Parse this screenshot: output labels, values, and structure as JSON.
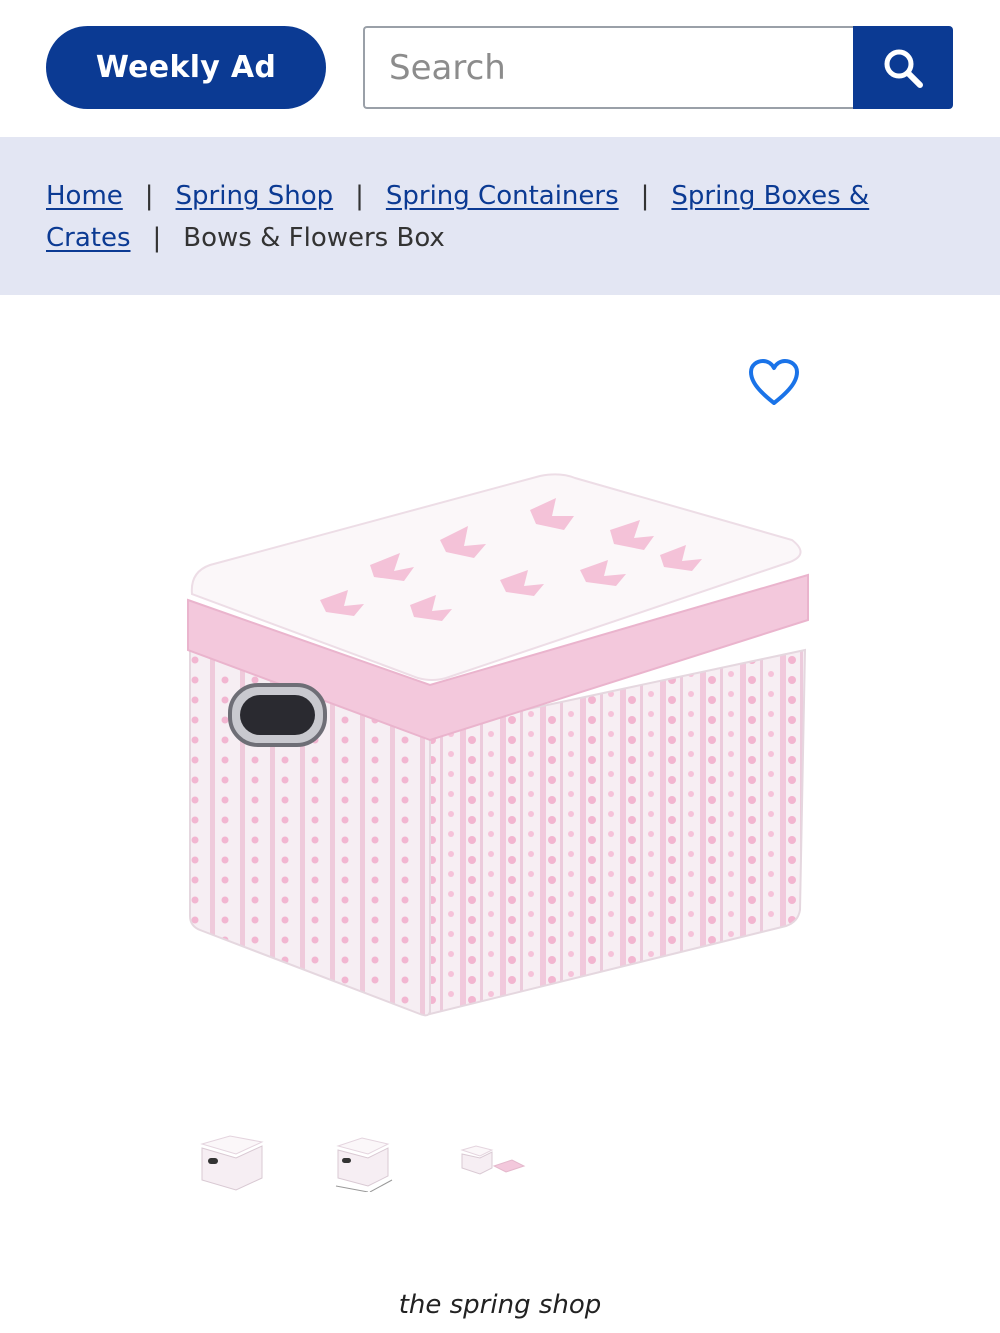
{
  "header": {
    "weekly_ad_label": "Weekly Ad",
    "search_placeholder": "Search",
    "search_icon": "search-icon"
  },
  "breadcrumb": {
    "items": [
      {
        "label": "Home",
        "link": true
      },
      {
        "label": "Spring Shop",
        "link": true
      },
      {
        "label": "Spring Containers",
        "link": true
      },
      {
        "label": "Spring Boxes &",
        "link": true
      },
      {
        "label": "Crates",
        "link": true
      },
      {
        "label": "Bows & Flowers Box",
        "link": false
      }
    ],
    "separator": "|"
  },
  "product": {
    "favorite_icon": "heart-outline-icon",
    "image_description_hidden": ""
  },
  "caption": "the spring shop",
  "colors": {
    "brand_blue": "#0b3a93",
    "breadcrumb_bg": "#e3e6f3",
    "heart_blue": "#1a73e8"
  }
}
